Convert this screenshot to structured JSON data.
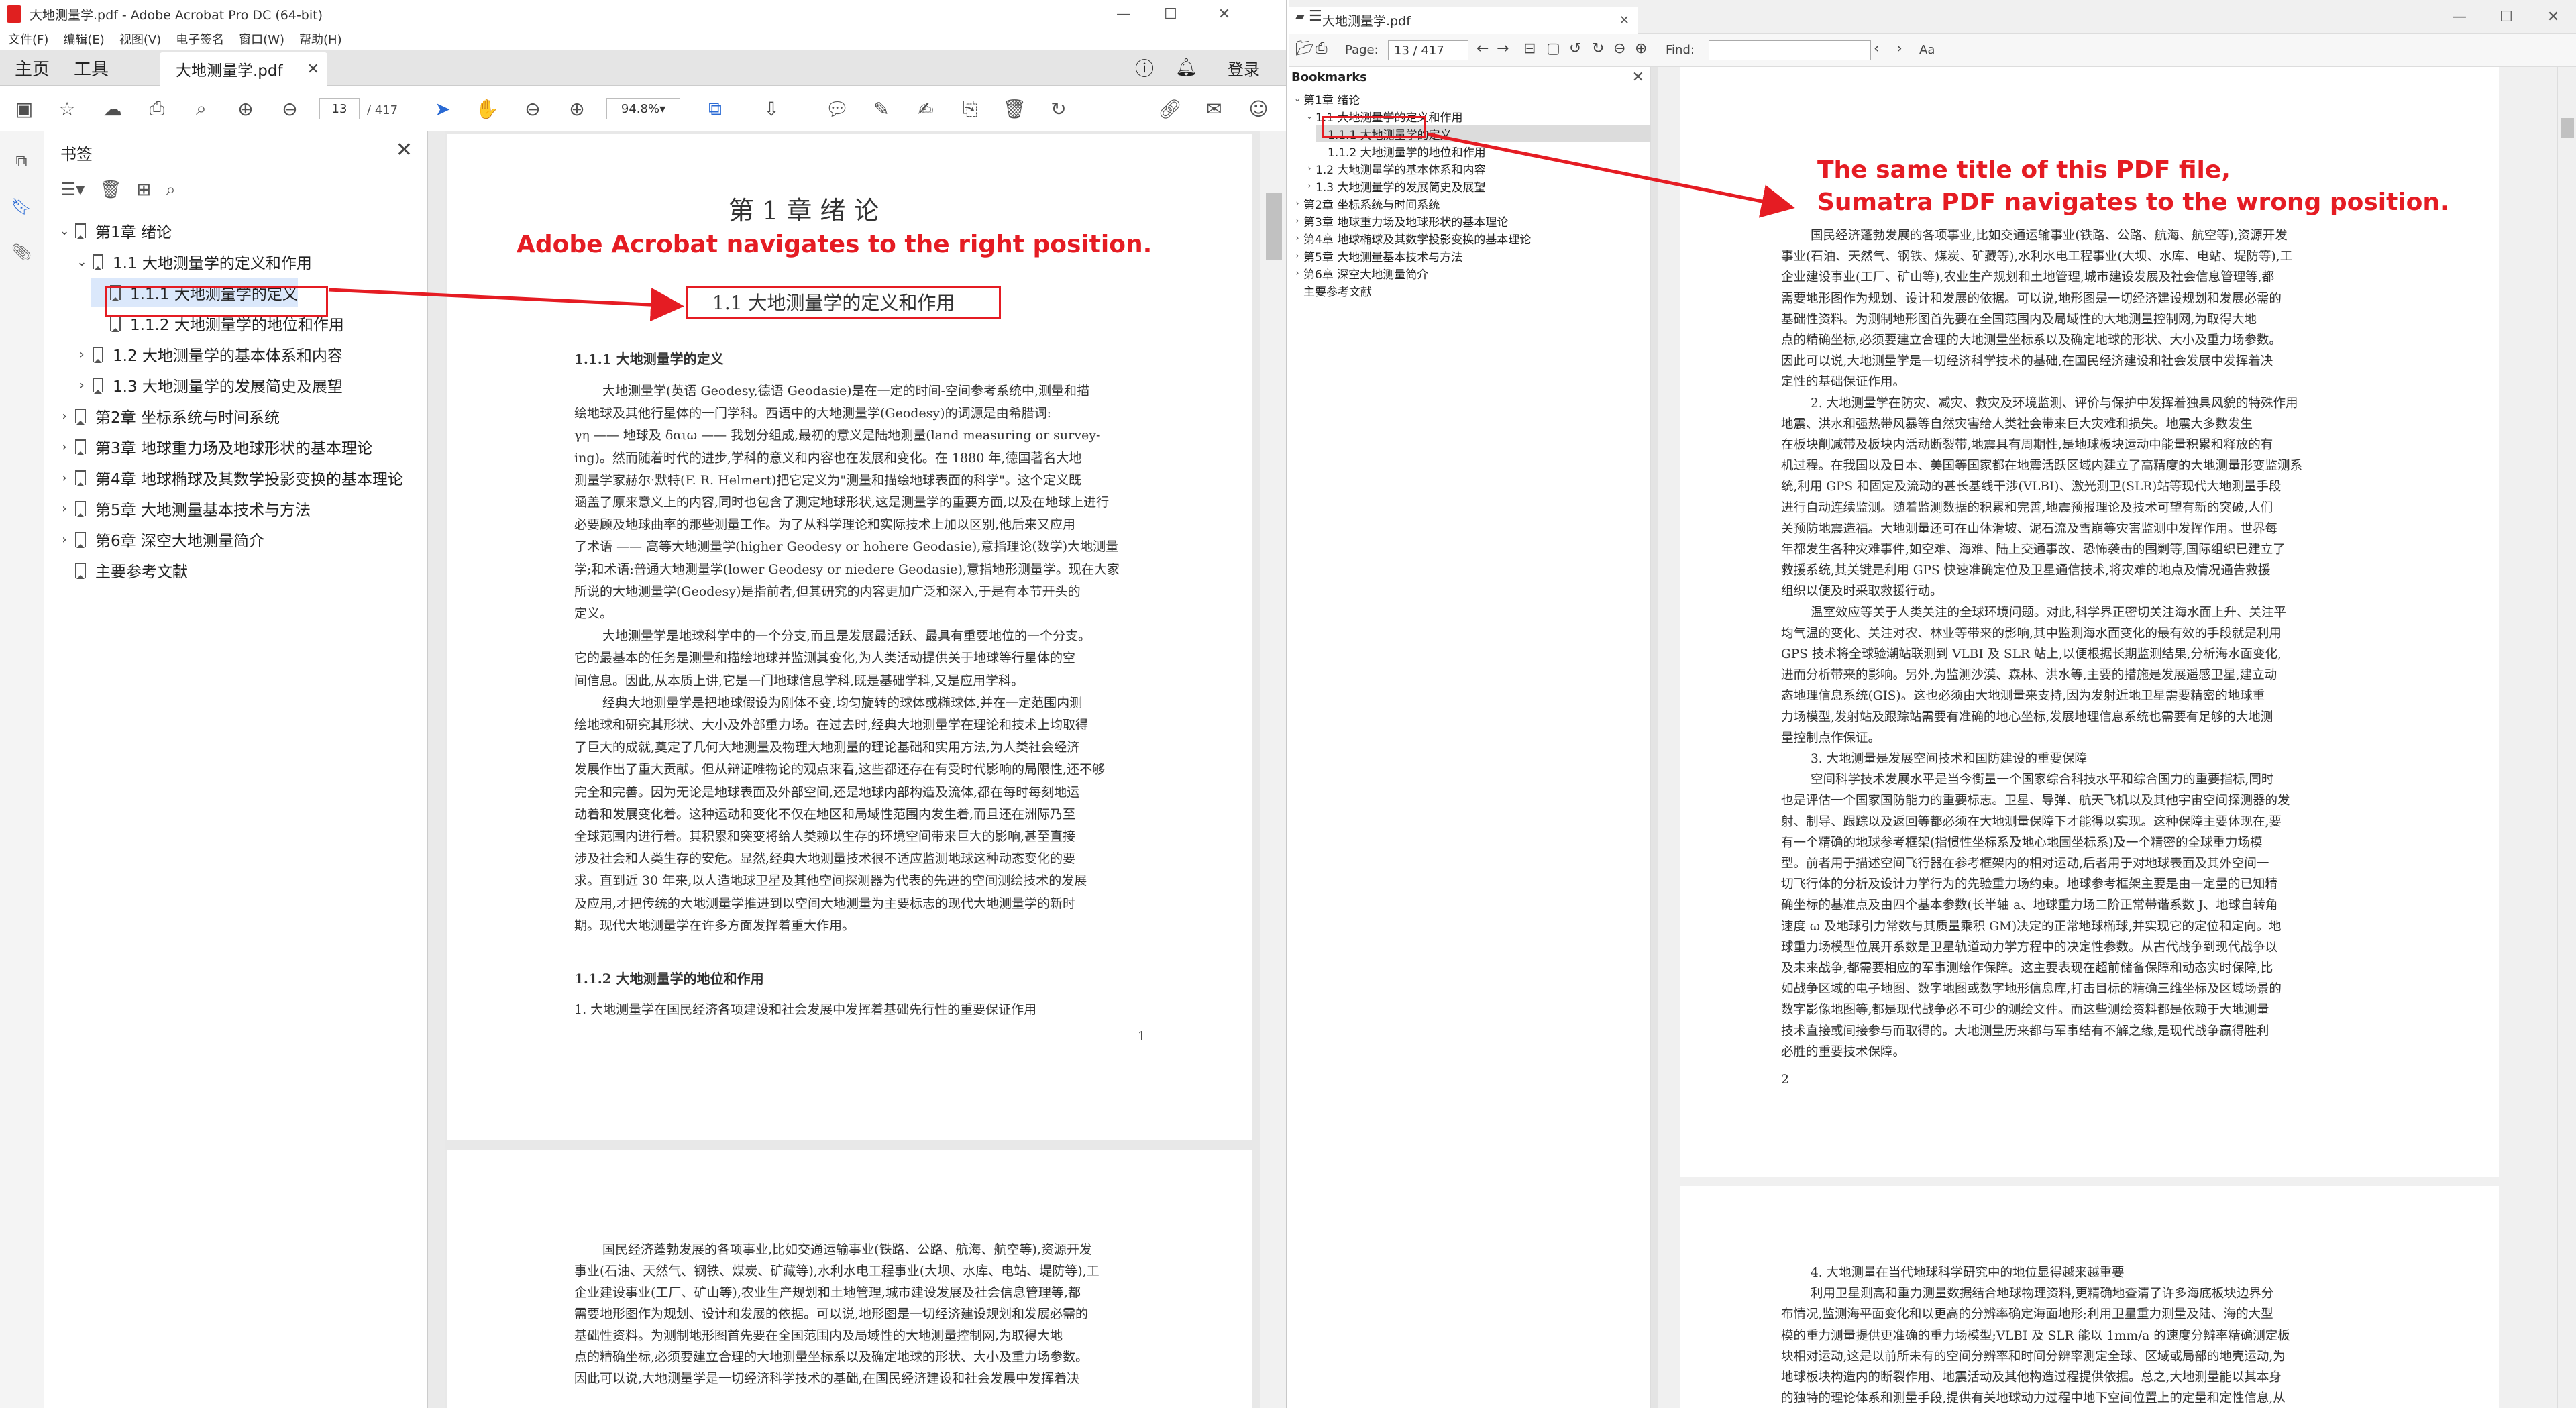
{
  "acrobat": {
    "title": "大地测量学.pdf - Adobe Acrobat Pro DC (64-bit)",
    "menu": [
      "文件(F)",
      "编辑(E)",
      "视图(V)",
      "电子签名",
      "窗口(W)",
      "帮助(H)"
    ],
    "tabs": {
      "home": "主页",
      "tools": "工具",
      "doc": "大地测量学.pdf",
      "login": "登录"
    },
    "page_current": "13",
    "page_total": "/ 417",
    "zoom": "94.8%",
    "bookmarks_title": "书签",
    "bookmarks": [
      {
        "label": "第1章 绪论",
        "toggle": "v"
      },
      {
        "label": "1.1  大地测量学的定义和作用",
        "toggle": "v"
      },
      {
        "label": "1.1.1  大地测量学的定义",
        "toggle": ""
      },
      {
        "label": "1.1.2  大地测量学的地位和作用",
        "toggle": ""
      },
      {
        "label": "1.2  大地测量学的基本体系和内容",
        "toggle": ">"
      },
      {
        "label": "1.3  大地测量学的发展简史及展望",
        "toggle": ">"
      },
      {
        "label": "第2章 坐标系统与时间系统",
        "toggle": ">"
      },
      {
        "label": "第3章 地球重力场及地球形状的基本理论",
        "toggle": ">"
      },
      {
        "label": "第4章 地球椭球及其数学投影变换的基本理论",
        "toggle": ">"
      },
      {
        "label": "第5章 大地测量基本技术与方法",
        "toggle": ">"
      },
      {
        "label": "第6章 深空大地测量简介",
        "toggle": ">"
      },
      {
        "label": "主要参考文献",
        "toggle": ""
      }
    ],
    "page1": {
      "chapter": "第 1 章    绪        论",
      "section": "1.1    大地测量学的定义和作用",
      "sub1": "1.1.1    大地测量学的定义",
      "lines": [
        "大地测量学(英语 Geodesy,德语 Geodasie)是在一定的时间-空间参考系统中,测量和描",
        "绘地球及其他行星体的一门学科。西语中的大地测量学(Geodesy)的词源是由希腊词:",
        "γη —— 地球及 δαιω —— 我划分组成,最初的意义是陆地测量(land measuring or survey-",
        "ing)。然而随着时代的进步,学科的意义和内容也在发展和变化。在 1880 年,德国著名大地",
        "测量学家赫尔·默特(F. R. Helmert)把它定义为\"测量和描绘地球表面的科学\"。这个定义既",
        "涵盖了原来意义上的内容,同时也包含了测定地球形状,这是测量学的重要方面,以及在地球上进行",
        "必要顾及地球曲率的那些测量工作。为了从科学理论和实际技术上加以区别,他后来又应用",
        "了术语 —— 高等大地测量学(higher Geodesy or hohere Geodasie),意指理论(数学)大地测量",
        "学;和术语:普通大地测量学(lower Geodesy or niedere Geodasie),意指地形测量学。现在大家",
        "所说的大地测量学(Geodesy)是指前者,但其研究的内容更加广泛和深入,于是有本节开头的",
        "定义。",
        "大地测量学是地球科学中的一个分支,而且是发展最活跃、最具有重要地位的一个分支。",
        "它的最基本的任务是测量和描绘地球并监测其变化,为人类活动提供关于地球等行星体的空",
        "间信息。因此,从本质上讲,它是一门地球信息学科,既是基础学科,又是应用学科。",
        "经典大地测量学是把地球假设为刚体不变,均匀旋转的球体或椭球体,并在一定范围内测",
        "绘地球和研究其形状、大小及外部重力场。在过去时,经典大地测量学在理论和技术上均取得",
        "了巨大的成就,奠定了几何大地测量及物理大地测量的理论基础和实用方法,为人类社会经济",
        "发展作出了重大贡献。但从辩证唯物论的观点来看,这些都还存在有受时代影响的局限性,还不够",
        "完全和完善。因为无论是地球表面及外部空间,还是地球内部构造及流体,都在每时每刻地运",
        "动着和发展变化着。这种运动和变化不仅在地区和局域性范围内发生着,而且还在洲际乃至",
        "全球范围内进行着。其积累和突变将给人类赖以生存的环境空间带来巨大的影响,甚至直接",
        "涉及社会和人类生存的安危。显然,经典大地测量技术很不适应监测地球这种动态变化的要",
        "求。直到近 30 年来,以人造地球卫星及其他空间探测器为代表的先进的空间测绘技术的发展",
        "及应用,才把传统的大地测量学推进到以空间大地测量为主要标志的现代大地测量学的新时",
        "期。现代大地测量学在许多方面发挥着重大作用。"
      ],
      "sub2": "1.1.2    大地测量学的地位和作用",
      "item1": "1. 大地测量学在国民经济各项建设和社会发展中发挥着基础先行性的重要保证作用",
      "pageno": "1"
    },
    "page2_lines": [
      "国民经济蓬勃发展的各项事业,比如交通运输事业(铁路、公路、航海、航空等),资源开发",
      "事业(石油、天然气、钢铁、煤炭、矿藏等),水利水电工程事业(大坝、水库、电站、堤防等),工",
      "企业建设事业(工厂、矿山等),农业生产规划和土地管理,城市建设发展及社会信息管理等,都",
      "需要地形图作为规划、设计和发展的依据。可以说,地形图是一切经济建设规划和发展必需的",
      "基础性资料。为测制地形图首先要在全国范围内及局域性的大地测量控制网,为取得大地",
      "点的精确坐标,必须要建立合理的大地测量坐标系以及确定地球的形状、大小及重力场参数。",
      "因此可以说,大地测量学是一切经济科学技术的基础,在国民经济建设和社会发展中发挥着决"
    ]
  },
  "sumatra": {
    "tab": "大地测量学.pdf",
    "page_label": "Page:",
    "page_value": "13 / 417",
    "find_label": "Find:",
    "bookmarks_title": "Bookmarks",
    "bookmarks": [
      {
        "label": "第1章 绪论",
        "toggle": "v"
      },
      {
        "label": "1.1 大地测量学的定义和作用",
        "toggle": "v"
      },
      {
        "label": "1.1.1 大地测量学的定义",
        "toggle": ""
      },
      {
        "label": "1.1.2 大地测量学的地位和作用",
        "toggle": ""
      },
      {
        "label": "1.2 大地测量学的基本体系和内容",
        "toggle": ">"
      },
      {
        "label": "1.3 大地测量学的发展简史及展望",
        "toggle": ">"
      },
      {
        "label": "第2章 坐标系统与时间系统",
        "toggle": ">"
      },
      {
        "label": "第3章 地球重力场及地球形状的基本理论",
        "toggle": ">"
      },
      {
        "label": "第4章 地球椭球及其数学投影变换的基本理论",
        "toggle": ">"
      },
      {
        "label": "第5章 大地测量基本技术与方法",
        "toggle": ">"
      },
      {
        "label": "第6章 深空大地测量简介",
        "toggle": ">"
      },
      {
        "label": "主要参考文献",
        "toggle": ""
      }
    ],
    "page_lines": [
      "国民经济蓬勃发展的各项事业,比如交通运输事业(铁路、公路、航海、航空等),资源开发",
      "事业(石油、天然气、钢铁、煤炭、矿藏等),水利水电工程事业(大坝、水库、电站、堤防等),工",
      "企业建设事业(工厂、矿山等),农业生产规划和土地管理,城市建设发展及社会信息管理等,都",
      "需要地形图作为规划、设计和发展的依据。可以说,地形图是一切经济建设规划和发展必需的",
      "基础性资料。为测制地形图首先要在全国范围内及局域性的大地测量控制网,为取得大地",
      "点的精确坐标,必须要建立合理的大地测量坐标系以及确定地球的形状、大小及重力场参数。",
      "因此可以说,大地测量学是一切经济科学技术的基础,在国民经济建设和社会发展中发挥着决",
      "定性的基础保证作用。",
      "2. 大地测量学在防灾、减灾、救灾及环境监测、评价与保护中发挥着独具风貌的特殊作用",
      "地震、洪水和强热带风暴等自然灾害给人类社会带来巨大灾难和损失。地震大多数发生",
      "在板块削减带及板块内活动断裂带,地震具有周期性,是地球板块运动中能量积累和释放的有",
      "机过程。在我国以及日本、美国等国家都在地震活跃区域内建立了高精度的大地测量形变监测系",
      "统,利用 GPS 和固定及流动的甚长基线干涉(VLBI)、激光测卫(SLR)站等现代大地测量手段",
      "进行自动连续监测。随着监测数据的积累和完善,地震预报理论及技术可望有新的突破,人们",
      "关预防地震造福。大地测量还可在山体滑坡、泥石流及雪崩等灾害监测中发挥作用。世界每",
      "年都发生各种灾难事件,如空难、海难、陆上交通事故、恐怖袭击的围剿等,国际组织已建立了",
      "救援系统,其关键是利用 GPS 快速准确定位及卫星通信技术,将灾难的地点及情况通告救援",
      "组织以便及时采取救援行动。",
      "温室效应等关于人类关注的全球环境问题。对此,科学界正密切关注海水面上升、关注平",
      "均气温的变化、关注对农、林业等带来的影响,其中监测海水面变化的最有效的手段就是利用",
      "GPS 技术将全球验潮站联测到 VLBI 及 SLR 站上,以便根据长期监测结果,分析海水面变化,",
      "进而分析带来的影响。另外,为监测沙漠、森林、洪水等,主要的措施是发展遥感卫星,建立动",
      "态地理信息系统(GIS)。这也必须由大地测量来支持,因为发射近地卫星需要精密的地球重",
      "力场模型,发射站及跟踪站需要有准确的地心坐标,发展地理信息系统也需要有足够的大地测",
      "量控制点作保证。",
      "3. 大地测量是发展空间技术和国防建设的重要保障",
      "空间科学技术发展水平是当今衡量一个国家综合科技水平和综合国力的重要指标,同时",
      "也是评估一个国家国防能力的重要标志。卫星、导弹、航天飞机以及其他宇宙空间探测器的发",
      "射、制导、跟踪以及返回等都必须在大地测量保障下才能得以实现。这种保障主要体现在,要",
      "有一个精确的地球参考框架(指惯性坐标系及地心地固坐标系)及一个精密的全球重力场模",
      "型。前者用于描述空间飞行器在参考框架内的相对运动,后者用于对地球表面及其外空间一",
      "切飞行体的分析及设计力学行为的先验重力场约束。地球参考框架主要是由一定量的已知精",
      "确坐标的基准点及由四个基本参数(长半轴 a、地球重力场二阶正常带谐系数 J、地球自转角",
      "速度 ω 及地球引力常数与其质量乘积 GM)决定的正常地球椭球,并实现它的定位和定向。地",
      "球重力场模型位展开系数是卫星轨道动力学方程中的决定性参数。从古代战争到现代战争以",
      "及未来战争,都需要相应的军事测绘作保障。这主要表现在超前储备保障和动态实时保障,比",
      "如战争区域的电子地图、数字地图或数字地形信息库,打击目标的精确三维坐标及区域场景的",
      "数字影像地图等,都是现代战争必不可少的测绘文件。而这些测绘资料都是依赖于大地测量",
      "技术直接或间接参与而取得的。大地测量历来都与军事结有不解之缘,是现代战争赢得胜利",
      "必胜的重要技术保障。"
    ],
    "page_no": "2",
    "page2_lines": [
      "4. 大地测量在当代地球科学研究中的地位显得越来越重要",
      "利用卫星测高和重力测量数据结合地球物理资料,更精确地查清了许多海底板块边界分",
      "布情况,监测海平面变化和以更高的分辨率确定海面地形;利用卫星重力测量及陆、海的大型",
      "模的重力测量提供更准确的重力场模型;VLBI 及 SLR 能以 1mm/a 的速度分辨率精确测定板",
      "块相对运动,这是以前所未有的空间分辨率和时间分辨率测定全球、区域或局部的地壳运动,为",
      "地球板块构造内的断裂作用、地震活动及其他构造过程提供依据。总之,大地测量能以其本身",
      "的独特的理论体系和测量手段,提供有关地球动力过程中地下空间位置上的定量和定性信息,从"
    ]
  },
  "annotations": {
    "acrobat": "Adobe Acrobat navigates to the right position.",
    "sumatra_line1": "The same title of this PDF file,",
    "sumatra_line2": "Sumatra PDF navigates to the wrong position.",
    "color": "#e51c23"
  }
}
